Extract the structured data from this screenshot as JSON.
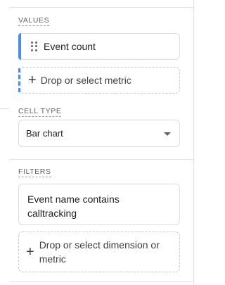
{
  "values": {
    "section_label": "VALUES",
    "metric_chip_label": "Event count",
    "drop_metric_label": "Drop or select metric"
  },
  "cell_type": {
    "section_label": "CELL TYPE",
    "selected_value": "Bar chart"
  },
  "filters": {
    "section_label": "FILTERS",
    "filter_chip_label": "Event name contains calltracking",
    "drop_dimension_label": "Drop or select dimension or metric"
  },
  "colors": {
    "accent": "#4a8af4",
    "border": "#dadce0"
  },
  "icons": [
    "drag-handle-icon",
    "plus-icon",
    "dropdown-caret-icon"
  ]
}
